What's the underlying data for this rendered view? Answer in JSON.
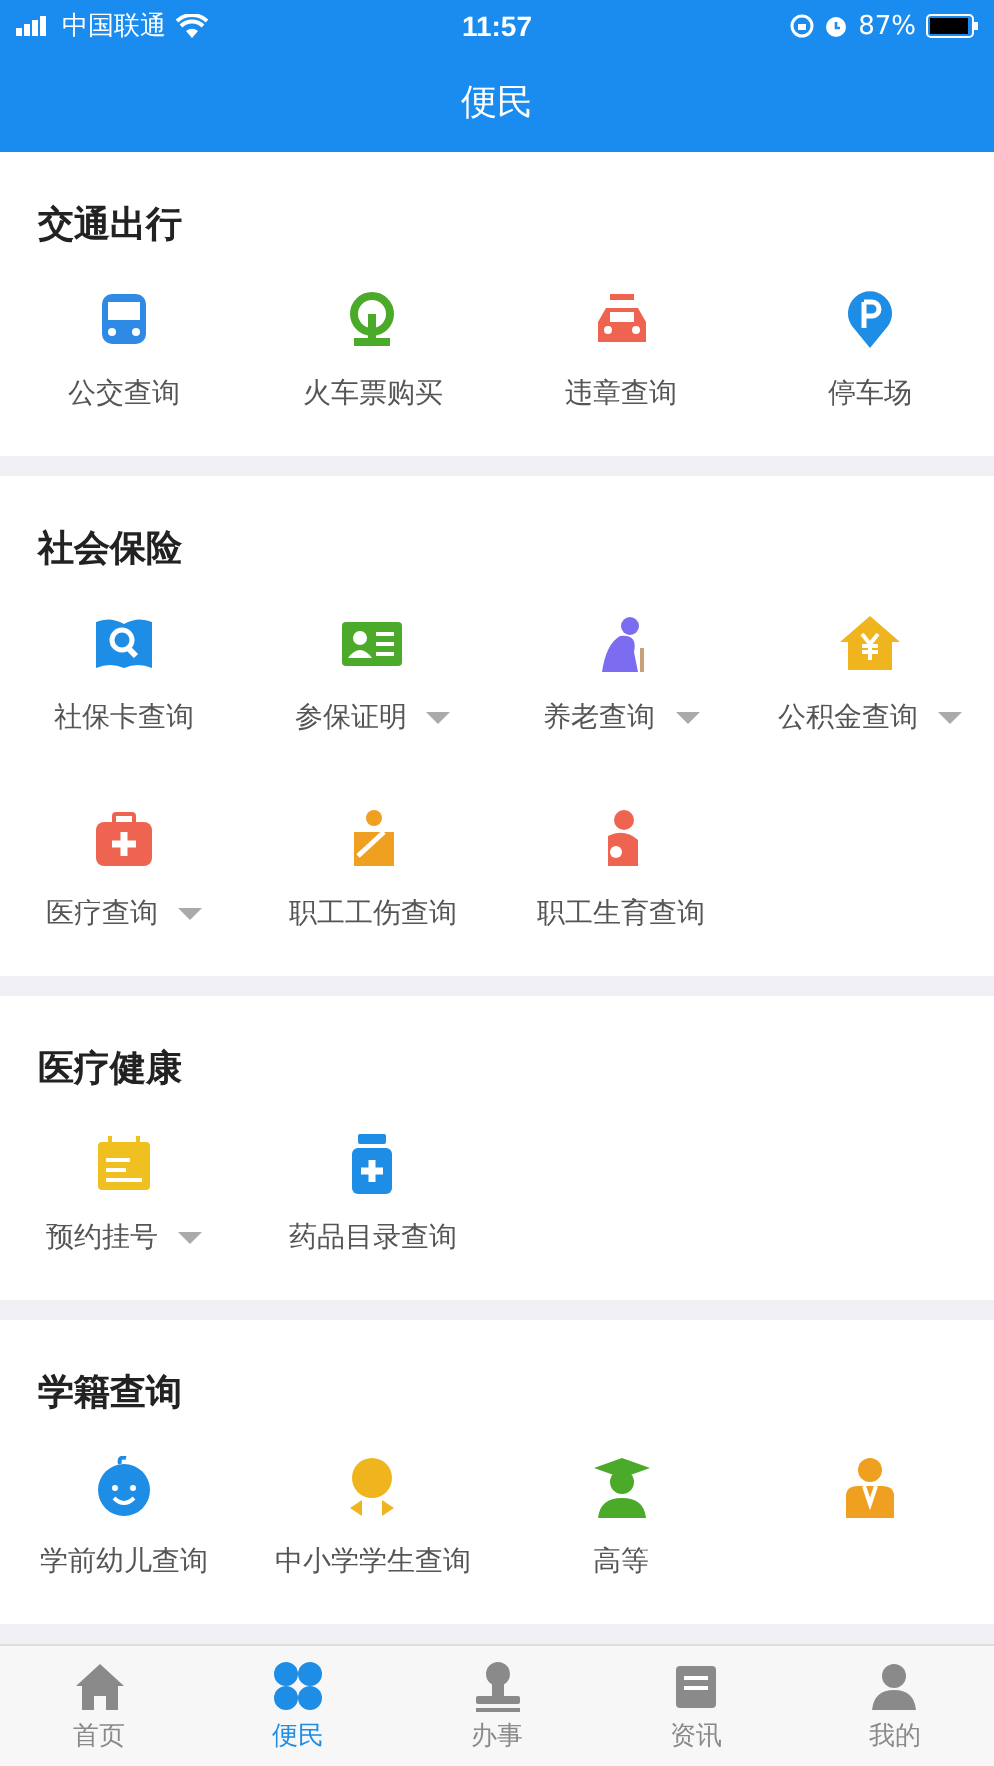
{
  "status_bar": {
    "carrier": "中国联通",
    "time": "11:57",
    "battery": "87%"
  },
  "header": {
    "title": "便民"
  },
  "sections": [
    {
      "title": "交通出行",
      "items": [
        {
          "kind": "service",
          "label": "公交查询",
          "dropdown": false
        },
        {
          "kind": "service",
          "label": "火车票购买",
          "dropdown": false
        },
        {
          "kind": "service",
          "label": "违章查询",
          "dropdown": false
        },
        {
          "kind": "service",
          "label": "停车场",
          "dropdown": false
        }
      ]
    },
    {
      "title": "社会保险",
      "items": [
        {
          "kind": "service",
          "label": "社保卡查询",
          "dropdown": false
        },
        {
          "kind": "service",
          "label": "参保证明",
          "dropdown": true
        },
        {
          "kind": "service",
          "label": "养老查询",
          "dropdown": true
        },
        {
          "kind": "service",
          "label": "公积金查询",
          "dropdown": true
        },
        {
          "kind": "service",
          "label": "医疗查询",
          "dropdown": true
        },
        {
          "kind": "service",
          "label": "职工工伤查询",
          "dropdown": false
        },
        {
          "kind": "service",
          "label": "职工生育查询",
          "dropdown": false
        }
      ]
    },
    {
      "title": "医疗健康",
      "items": [
        {
          "kind": "service",
          "label": "预约挂号",
          "dropdown": true
        },
        {
          "kind": "service",
          "label": "药品目录查询",
          "dropdown": false
        }
      ]
    },
    {
      "title": "学籍查询",
      "items": [
        {
          "kind": "service",
          "label": "学前幼儿查询",
          "dropdown": false
        },
        {
          "kind": "service",
          "label": "中小学学生查询",
          "dropdown": false
        },
        {
          "kind": "service",
          "label": "高等",
          "dropdown": false
        },
        {
          "kind": "icon_only"
        }
      ]
    }
  ],
  "tab_bar": [
    {
      "label": "首页",
      "selected": false
    },
    {
      "label": "便民",
      "selected": true
    },
    {
      "label": "办事",
      "selected": false
    },
    {
      "label": "资讯",
      "selected": false
    },
    {
      "label": "我的",
      "selected": false
    }
  ]
}
